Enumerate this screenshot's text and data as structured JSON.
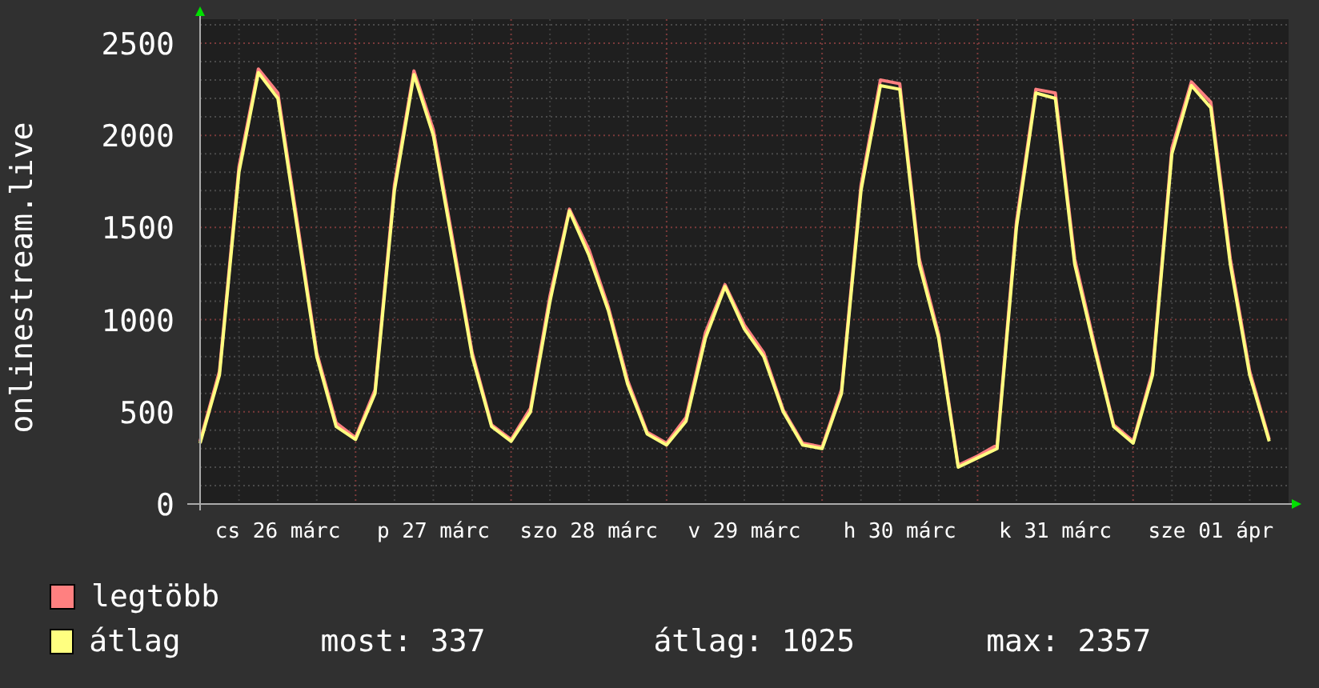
{
  "chart": {
    "chart_data": {
      "type": "line",
      "ylabel": "onlinestream.live",
      "grid": true,
      "categories": [
        null,
        null,
        null,
        null,
        "cs 26 márc",
        null,
        null,
        null,
        null,
        null,
        null,
        null,
        "p 27 márc",
        null,
        null,
        null,
        null,
        null,
        null,
        null,
        "szo 28 márc",
        null,
        null,
        null,
        null,
        null,
        null,
        null,
        "v 29 márc",
        null,
        null,
        null,
        null,
        null,
        null,
        null,
        "h 30 márc",
        null,
        null,
        null,
        null,
        null,
        null,
        null,
        "k 31 márc",
        null,
        null,
        null,
        null,
        null,
        null,
        null,
        "sze 01 ápr",
        null,
        null,
        null
      ],
      "series": [
        {
          "name": "legtöbb",
          "color": "#ff8080",
          "values": [
            340,
            720,
            1830,
            2360,
            2230,
            1530,
            820,
            440,
            360,
            620,
            1730,
            2350,
            2030,
            1430,
            820,
            430,
            350,
            520,
            1130,
            1600,
            1380,
            1070,
            670,
            390,
            330,
            470,
            930,
            1190,
            970,
            820,
            510,
            330,
            310,
            620,
            1730,
            2300,
            2280,
            1330,
            920,
            210,
            260,
            320,
            1530,
            2250,
            2230,
            1330,
            870,
            430,
            340,
            720,
            1930,
            2290,
            2180,
            1330,
            720,
            350
          ]
        },
        {
          "name": "átlag",
          "color": "#ffff80",
          "values": [
            330,
            700,
            1800,
            2340,
            2200,
            1500,
            800,
            420,
            350,
            600,
            1700,
            2330,
            2000,
            1400,
            800,
            420,
            340,
            500,
            1100,
            1590,
            1350,
            1050,
            650,
            380,
            320,
            450,
            900,
            1180,
            950,
            800,
            500,
            320,
            300,
            600,
            1700,
            2270,
            2250,
            1300,
            900,
            200,
            250,
            300,
            1500,
            2230,
            2200,
            1300,
            850,
            420,
            330,
            700,
            1900,
            2270,
            2150,
            1300,
            700,
            340
          ]
        }
      ],
      "ylim": [
        0,
        2630
      ],
      "yticks": [
        0,
        500,
        1000,
        1500,
        2000,
        2500
      ]
    }
  },
  "legend_stats": [
    "most: 337",
    "átlag: 1025",
    "max: 2357"
  ]
}
